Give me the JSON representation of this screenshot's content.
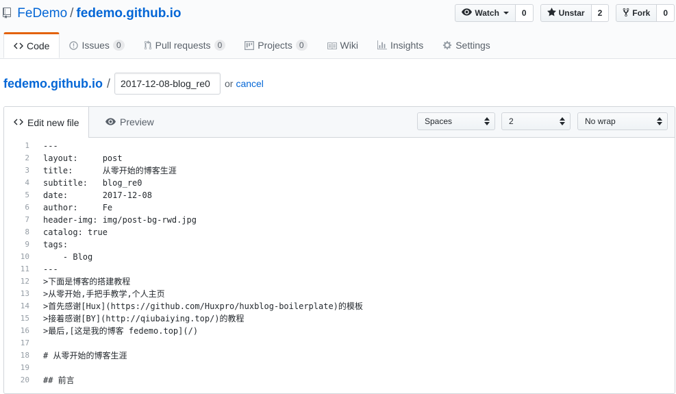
{
  "repo": {
    "owner": "FeDemo",
    "separator": "/",
    "name": "fedemo.github.io"
  },
  "actions": {
    "watch": {
      "label": "Watch",
      "count": "0"
    },
    "unstar": {
      "label": "Unstar",
      "count": "2"
    },
    "fork": {
      "label": "Fork",
      "count": "0"
    }
  },
  "tabs": [
    {
      "label": "Code",
      "icon": "code-icon"
    },
    {
      "label": "Issues",
      "count": "0",
      "icon": "issue-icon"
    },
    {
      "label": "Pull requests",
      "count": "0",
      "icon": "pull-request-icon"
    },
    {
      "label": "Projects",
      "count": "0",
      "icon": "project-icon"
    },
    {
      "label": "Wiki",
      "icon": "book-icon"
    },
    {
      "label": "Insights",
      "icon": "graph-icon"
    },
    {
      "label": "Settings",
      "icon": "gear-icon"
    }
  ],
  "breadcrumb": {
    "root": "fedemo.github.io",
    "slash": "/",
    "filename_value": "2017-12-08-blog_re0",
    "or_text": "or",
    "cancel_label": "cancel"
  },
  "editor": {
    "edit_tab": "Edit new file",
    "preview_tab": "Preview",
    "indent_mode": "Spaces",
    "indent_size": "2",
    "wrap_mode": "No wrap",
    "lines": [
      "---",
      "layout:     post",
      "title:      从零开始的博客生涯",
      "subtitle:   blog_re0",
      "date:       2017-12-08",
      "author:     Fe",
      "header-img: img/post-bg-rwd.jpg",
      "catalog: true",
      "tags:",
      "    - Blog",
      "---",
      ">下面是博客的搭建教程",
      ">从零开始,手把手教学,个人主页",
      ">首先感谢[Hux](https://github.com/Huxpro/huxblog-boilerplate)的模板",
      ">接着感谢[BY](http://qiubaiying.top/)的教程",
      ">最后,[这是我的博客 fedemo.top](/)",
      "",
      "# 从零开始的博客生涯",
      "",
      "## 前言"
    ]
  }
}
